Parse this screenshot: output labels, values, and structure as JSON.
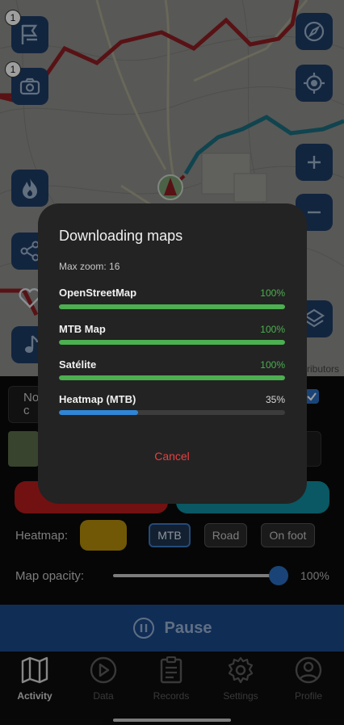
{
  "map": {
    "badges": {
      "marker_count": "1",
      "photo_count": "1"
    },
    "attribution": "ributors"
  },
  "panel": {
    "partial_left_text": "No\nc",
    "heatmap_label": "Heatmap:",
    "heatmap_color": "#b58e0a",
    "heatmap_options": [
      {
        "label": "MTB",
        "active": true
      },
      {
        "label": "Road",
        "active": false
      },
      {
        "label": "On foot",
        "active": false
      }
    ],
    "opacity_label": "Map opacity:",
    "opacity_value": "100%",
    "opacity_level": 1.0,
    "pause_label": "Pause"
  },
  "tabs": [
    {
      "label": "Activity",
      "icon": "map-icon",
      "active": true
    },
    {
      "label": "Data",
      "icon": "play-icon",
      "active": false
    },
    {
      "label": "Records",
      "icon": "clipboard-icon",
      "active": false
    },
    {
      "label": "Settings",
      "icon": "gear-icon",
      "active": false
    },
    {
      "label": "Profile",
      "icon": "user-icon",
      "active": false
    }
  ],
  "dialog": {
    "title": "Downloading maps",
    "max_zoom": "Max zoom: 16",
    "downloads": [
      {
        "name": "OpenStreetMap",
        "percent": "100%",
        "progress": 1.0,
        "color": "#4caf50"
      },
      {
        "name": "MTB Map",
        "percent": "100%",
        "progress": 1.0,
        "color": "#4caf50"
      },
      {
        "name": "Satélite",
        "percent": "100%",
        "progress": 1.0,
        "color": "#4caf50"
      },
      {
        "name": "Heatmap (MTB)",
        "percent": "35%",
        "progress": 0.35,
        "color": "#2f86d6"
      }
    ],
    "cancel_label": "Cancel"
  },
  "colors": {
    "accent": "#1e3c66",
    "route_red": "#c4262e",
    "route_blue": "#1f9cb0",
    "done_green": "#4caf50",
    "pending_green_text": "#4caf50"
  }
}
